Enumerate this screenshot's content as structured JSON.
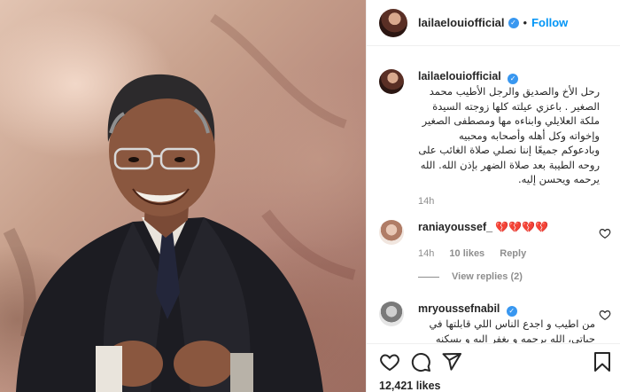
{
  "post": {
    "username": "lailaelouiofficial",
    "follow_label": "Follow",
    "dot": "•",
    "caption_username": "lailaelouiofficial",
    "caption_text": "رحل الأخ والصديق والرجل الأطيب محمد الصغير . باعزي عيلته كلها زوجته السيدة ملكة العلايلي وابناءه مها ومصطفى الصغير وإخواته وكل أهله وأصحابه ومحبيه وبادعوكم جميعًا إننا نصلي صلاة الغائب على روحه الطيبة بعد صلاة الضهر بإذن الله. الله يرحمه ويحسن إليه.",
    "caption_time": "14h",
    "likes": "12,421 likes"
  },
  "comments": [
    {
      "username": "raniayoussef_",
      "text": "💔💔💔💔",
      "time": "14h",
      "likes": "10 likes",
      "reply": "Reply",
      "view_replies": "View replies (2)"
    },
    {
      "username": "mryoussefnabil",
      "text": "من اطيب و اجدع الناس اللي قابلتها في حياتي، الله يرحمه و يغفر اليه و يسكنه فسيح"
    }
  ],
  "icons": [
    "verified-badge-icon",
    "heart-icon",
    "comment-icon",
    "share-icon",
    "bookmark-icon"
  ],
  "colors": {
    "link": "#0095f6",
    "verified": "#3897f0",
    "muted": "#8e8e8e",
    "broken_heart": "#c81d2b"
  }
}
